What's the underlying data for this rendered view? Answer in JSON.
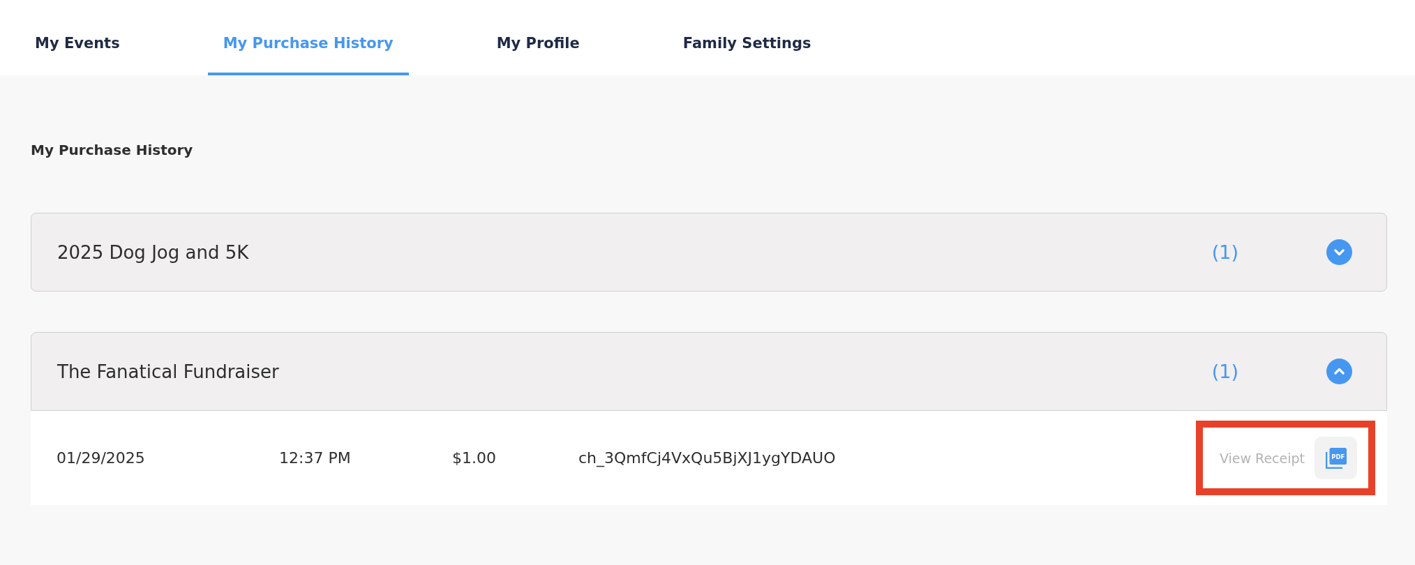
{
  "tabs": [
    {
      "label": "My Events",
      "selected": false
    },
    {
      "label": "My Purchase History",
      "selected": true
    },
    {
      "label": "My Profile",
      "selected": false
    },
    {
      "label": "Family Settings",
      "selected": false
    }
  ],
  "heading": "My Purchase History",
  "purchases": [
    {
      "event": "2025 Dog Jog and 5K",
      "count": "(1)",
      "expanded": false
    },
    {
      "event": "The Fanatical Fundraiser",
      "count": "(1)",
      "expanded": true,
      "rows": [
        {
          "date": "01/29/2025",
          "time": "12:37 PM",
          "amount": "$1.00",
          "charge_id": "ch_3QmfCj4VxQu5BjXJ1ygYDAUO",
          "action": "View Receipt",
          "file_type": "PDF",
          "highlighted": true
        }
      ]
    }
  ]
}
